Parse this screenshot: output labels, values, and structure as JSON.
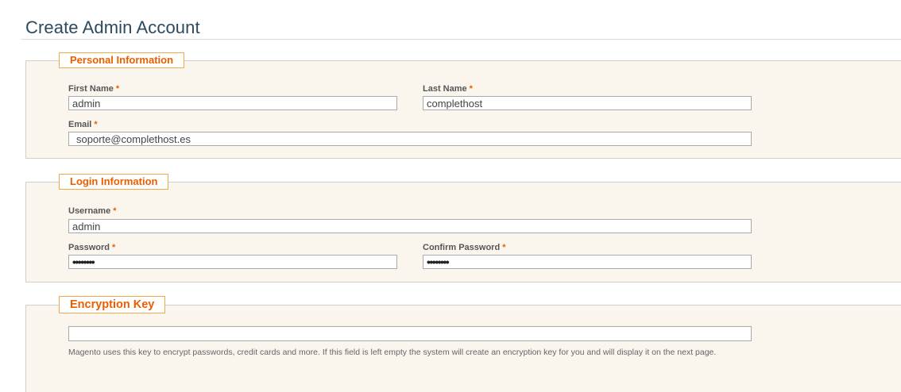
{
  "page": {
    "title": "Create Admin Account"
  },
  "personal": {
    "legend": "Personal Information",
    "first_name": {
      "label": "First Name",
      "value": "admin"
    },
    "last_name": {
      "label": "Last Name",
      "value": "complethost"
    },
    "email": {
      "label": "Email",
      "value": "soporte@complethost.es"
    }
  },
  "login": {
    "legend": "Login Information",
    "username": {
      "label": "Username",
      "value": "admin"
    },
    "password": {
      "label": "Password",
      "value": "••••••••"
    },
    "confirm_password": {
      "label": "Confirm Password",
      "value": "••••••••"
    }
  },
  "encryption": {
    "legend": "Encryption Key",
    "value": "",
    "note": "Magento uses this key to encrypt passwords, credit cards and more. If this field is left empty the system will create an encryption key for you and will display it on the next page."
  },
  "required_marker": "*",
  "colors": {
    "accent": "#eb5e00",
    "panel_bg": "#faf6ee",
    "title": "#2b4a5e"
  }
}
